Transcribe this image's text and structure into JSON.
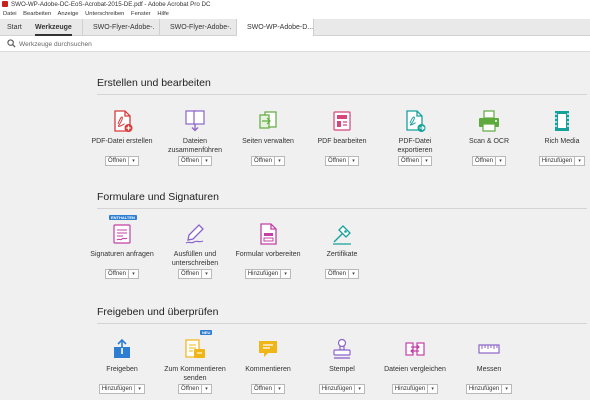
{
  "window": {
    "title": "SWO-WP-Adobe-DC-EoS-Acrobat-2015-DE.pdf - Adobe Acrobat Pro DC"
  },
  "menu": [
    "Datei",
    "Bearbeiten",
    "Anzeige",
    "Unterschreiben",
    "Fenster",
    "Hilfe"
  ],
  "tabs": {
    "home": "Start",
    "tools": "Werkzeuge",
    "doc1": "SWO-Flyer-Adobe-...",
    "doc2": "SWO-Flyer-Adobe-...",
    "doc3": "SWO-WP-Adobe-D..."
  },
  "search": {
    "placeholder": "Werkzeuge durchsuchen"
  },
  "colors": {
    "red": "#d83b3b",
    "purple": "#8b63c9",
    "green": "#5faa3e",
    "pink": "#d6457b",
    "teal": "#16a19b",
    "magenta": "#c43fa6",
    "blue": "#2d7dd2",
    "yellow": "#f0b517"
  },
  "sections": [
    {
      "title": "Erstellen und bearbeiten",
      "tools": [
        {
          "label": "PDF-Datei erstellen",
          "action": "Öffnen",
          "icon": "create-pdf-icon"
        },
        {
          "label": "Dateien zusammenführen",
          "action": "Öffnen",
          "icon": "combine-files-icon"
        },
        {
          "label": "Seiten verwalten",
          "action": "Öffnen",
          "icon": "organize-pages-icon"
        },
        {
          "label": "PDF bearbeiten",
          "action": "Öffnen",
          "icon": "edit-pdf-icon"
        },
        {
          "label": "PDF-Datei exportieren",
          "action": "Öffnen",
          "icon": "export-pdf-icon"
        },
        {
          "label": "Scan & OCR",
          "action": "Öffnen",
          "icon": "scan-ocr-icon"
        },
        {
          "label": "Rich Media",
          "action": "Hinzufügen",
          "icon": "rich-media-icon"
        }
      ]
    },
    {
      "title": "Formulare und Signaturen",
      "tools": [
        {
          "label": "Signaturen anfragen",
          "action": "Öffnen",
          "icon": "request-signatures-icon",
          "badge": "ENTHALTEN"
        },
        {
          "label": "Ausfüllen und unterschreiben",
          "action": "Öffnen",
          "icon": "fill-sign-icon"
        },
        {
          "label": "Formular vorbereiten",
          "action": "Hinzufügen",
          "icon": "prepare-form-icon"
        },
        {
          "label": "Zertifikate",
          "action": "Öffnen",
          "icon": "certificates-icon"
        }
      ]
    },
    {
      "title": "Freigeben und überprüfen",
      "tools": [
        {
          "label": "Freigeben",
          "action": "Hinzufügen",
          "icon": "share-icon"
        },
        {
          "label": "Zum Kommentieren senden",
          "action": "Öffnen",
          "icon": "send-for-comments-icon",
          "badge": "NEU"
        },
        {
          "label": "Kommentieren",
          "action": "Öffnen",
          "icon": "comment-icon"
        },
        {
          "label": "Stempel",
          "action": "Hinzufügen",
          "icon": "stamp-icon"
        },
        {
          "label": "Dateien vergleichen",
          "action": "Hinzufügen",
          "icon": "compare-files-icon"
        },
        {
          "label": "Messen",
          "action": "Hinzufügen",
          "icon": "measure-icon"
        }
      ]
    }
  ]
}
